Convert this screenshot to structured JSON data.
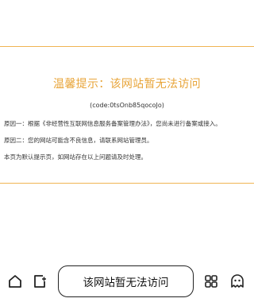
{
  "notice": {
    "title": "温馨提示：该网站暂无法访问",
    "code": "(code:0tsOnb85qocoJo)",
    "reasons": [
      "原因一：根据《非经营性互联网信息服务备案管理办法》，您尚未进行备案或接入。",
      "原因二：您的网站可能含不良信息，请联系网站管理员。",
      "本页为默认提示页，如网站存在以上问题请及时处理。"
    ]
  },
  "toolbar": {
    "url_title": "该网站暂无法访问",
    "icons": [
      "home-icon",
      "tabs-icon",
      "apps-icon",
      "ghost-icon"
    ]
  },
  "colors": {
    "accent": "#e8a53a",
    "border": "#f0b453"
  }
}
